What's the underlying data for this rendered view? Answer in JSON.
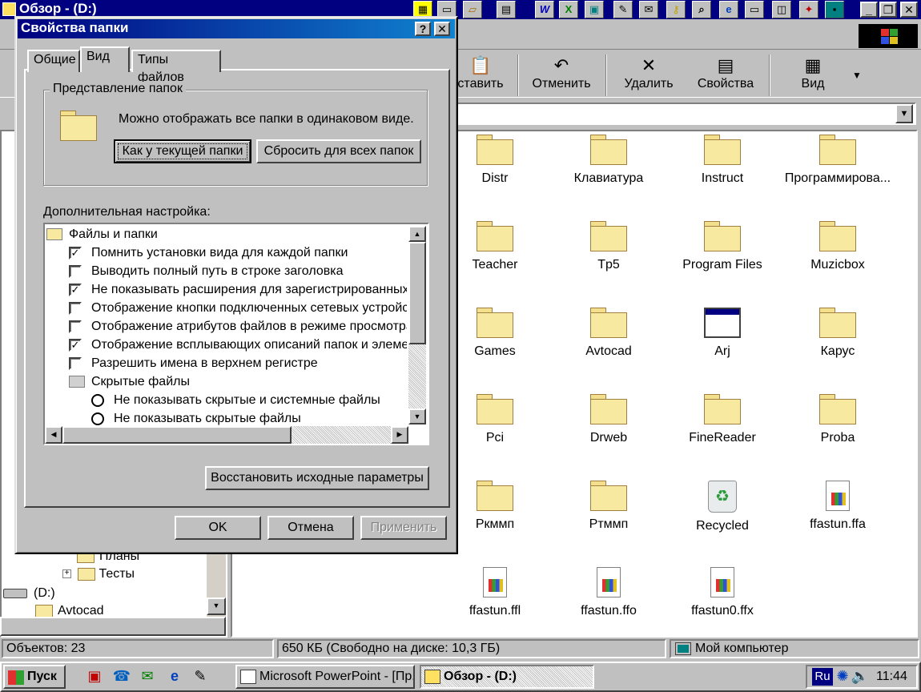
{
  "explorer": {
    "title": "Обзор -  (D:)",
    "toolbar": [
      {
        "label": "ставить",
        "icon": "paste-icon"
      },
      {
        "label": "Отменить",
        "icon": "undo-icon"
      },
      {
        "label": "Удалить",
        "icon": "delete-icon"
      },
      {
        "label": "Свойства",
        "icon": "properties-icon"
      },
      {
        "label": "Вид",
        "icon": "view-icon"
      }
    ],
    "files": [
      {
        "name": "Distr",
        "type": "folder"
      },
      {
        "name": "Клавиатура",
        "type": "folder"
      },
      {
        "name": "Instruct",
        "type": "folder"
      },
      {
        "name": "Программирова...",
        "type": "folder"
      },
      {
        "name": "Teacher",
        "type": "folder"
      },
      {
        "name": "Tp5",
        "type": "folder"
      },
      {
        "name": "Program Files",
        "type": "folder"
      },
      {
        "name": "Muzicbox",
        "type": "folder"
      },
      {
        "name": "Games",
        "type": "folder"
      },
      {
        "name": "Avtocad",
        "type": "folder"
      },
      {
        "name": "Arj",
        "type": "app"
      },
      {
        "name": "Карус",
        "type": "folder"
      },
      {
        "name": "Pci",
        "type": "folder"
      },
      {
        "name": "Drweb",
        "type": "folder"
      },
      {
        "name": "FineReader",
        "type": "folder"
      },
      {
        "name": "Proba",
        "type": "folder"
      },
      {
        "name": "Ркммп",
        "type": "folder"
      },
      {
        "name": "Ртммп",
        "type": "folder"
      },
      {
        "name": "Recycled",
        "type": "recycle"
      },
      {
        "name": "ffastun.ffa",
        "type": "doc"
      },
      {
        "name": "ffastun.ffl",
        "type": "doc"
      },
      {
        "name": "ffastun.ffo",
        "type": "doc"
      },
      {
        "name": "ffastun0.ffx",
        "type": "doc"
      }
    ],
    "tree": {
      "items": [
        {
          "label": "Планы"
        },
        {
          "label": "Тесты"
        },
        {
          "label": "(D:)"
        },
        {
          "label": "Avtocad"
        }
      ]
    },
    "status": {
      "objects": "Объектов: 23",
      "size": "650 КБ (Свободно на диске: 10,3 ГБ)",
      "location": "Мой компьютер"
    }
  },
  "dialog": {
    "title": "Свойства папки",
    "help": "?",
    "close": "✕",
    "tabs": [
      "Общие",
      "Вид",
      "Типы файлов"
    ],
    "group_title": "Представление папок",
    "group_text": "Можно отображать все папки в одинаковом виде.",
    "btn_current": "Как у текущей папки",
    "btn_reset": "Сбросить для всех папок",
    "advanced_label": "Дополнительная настройка:",
    "list": [
      {
        "kind": "folder",
        "label": "Файлы и папки"
      },
      {
        "kind": "check",
        "checked": true,
        "label": "Помнить установки вида для каждой папки"
      },
      {
        "kind": "check",
        "checked": false,
        "label": "Выводить полный путь в строке заголовка"
      },
      {
        "kind": "check",
        "checked": true,
        "label": "Не показывать расширения для зарегистрированных"
      },
      {
        "kind": "check",
        "checked": false,
        "label": "Отображение кнопки подключенных сетевых устройств"
      },
      {
        "kind": "check",
        "checked": false,
        "label": "Отображение атрибутов файлов в режиме просмотра"
      },
      {
        "kind": "check",
        "checked": true,
        "label": "Отображение всплывающих описаний папок и элементов"
      },
      {
        "kind": "check",
        "checked": false,
        "label": "Разрешить имена в верхнем регистре"
      },
      {
        "kind": "folder2",
        "label": "Скрытые файлы"
      },
      {
        "kind": "radio",
        "label": "Не показывать скрытые и системные файлы"
      },
      {
        "kind": "radio",
        "label": "Не показывать скрытые файлы"
      }
    ],
    "btn_restore": "Восстановить исходные параметры",
    "btn_ok": "OK",
    "btn_cancel": "Отмена",
    "btn_apply": "Применить"
  },
  "taskbar": {
    "start": "Пуск",
    "tasks": [
      "Microsoft PowerPoint - [Пр...",
      "Обзор -  (D:)"
    ],
    "lang": "Ru",
    "clock": "11:44"
  }
}
